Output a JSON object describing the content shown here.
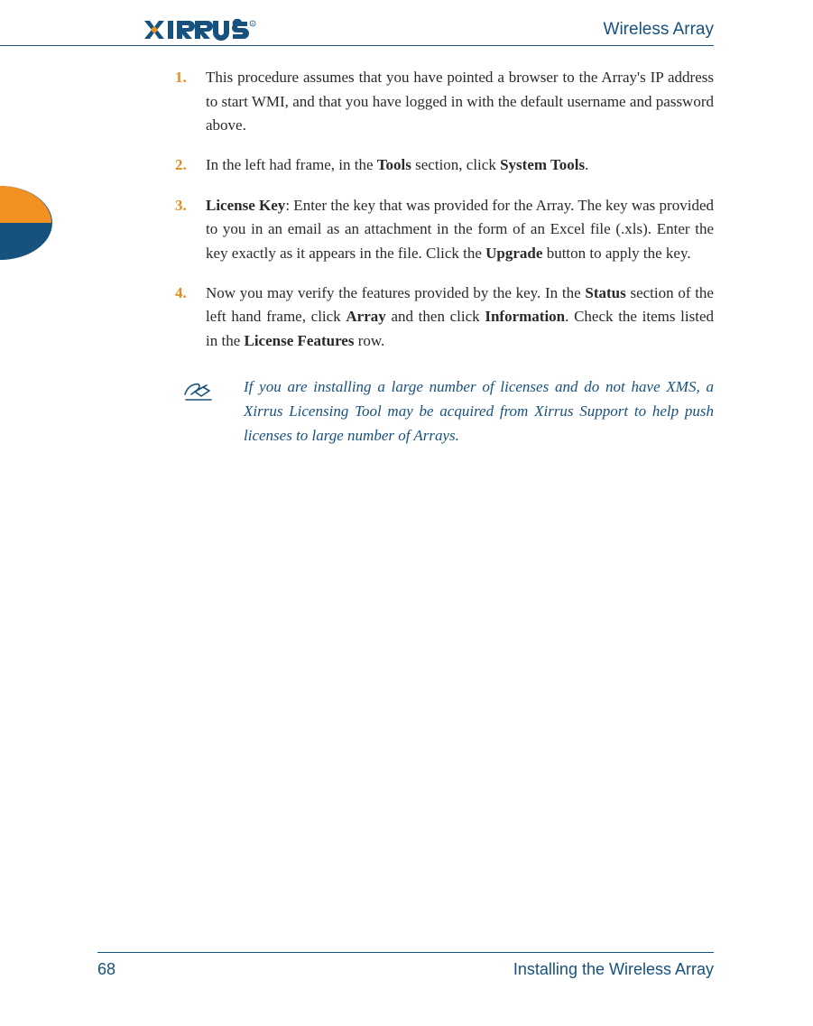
{
  "header": {
    "product": "Wireless Array"
  },
  "steps": {
    "n1": "1.",
    "t1a": "This procedure assumes that you have pointed a browser to the Array's IP address to start WMI, and that you have logged in with the default username and password above.",
    "n2": "2.",
    "t2a": "In the left had frame, in the ",
    "t2b": "Tools",
    "t2c": " section, click ",
    "t2d": "System Tools",
    "t2e": ".",
    "n3": "3.",
    "t3a": "License Key",
    "t3b": ": Enter the key that was provided for the Array. The key was provided to you in an email as an attachment in the form of an Excel file (.xls). Enter the key exactly as it appears in the file. Click the ",
    "t3c": "Upgrade",
    "t3d": " button to apply the key.",
    "n4": "4.",
    "t4a": "Now you may verify the features provided by the key. In the ",
    "t4b": "Status",
    "t4c": " section of the left hand frame, click ",
    "t4d": "Array",
    "t4e": " and then click ",
    "t4f": "Information",
    "t4g": ". Check the items listed in the ",
    "t4h": "License Features",
    "t4i": " row."
  },
  "note": "If you are installing a large number of licenses and do not have XMS, a Xirrus Licensing Tool may be acquired from Xirrus Support to help push licenses to large number of Arrays.",
  "footer": {
    "page": "68",
    "section": "Installing the Wireless Array"
  }
}
